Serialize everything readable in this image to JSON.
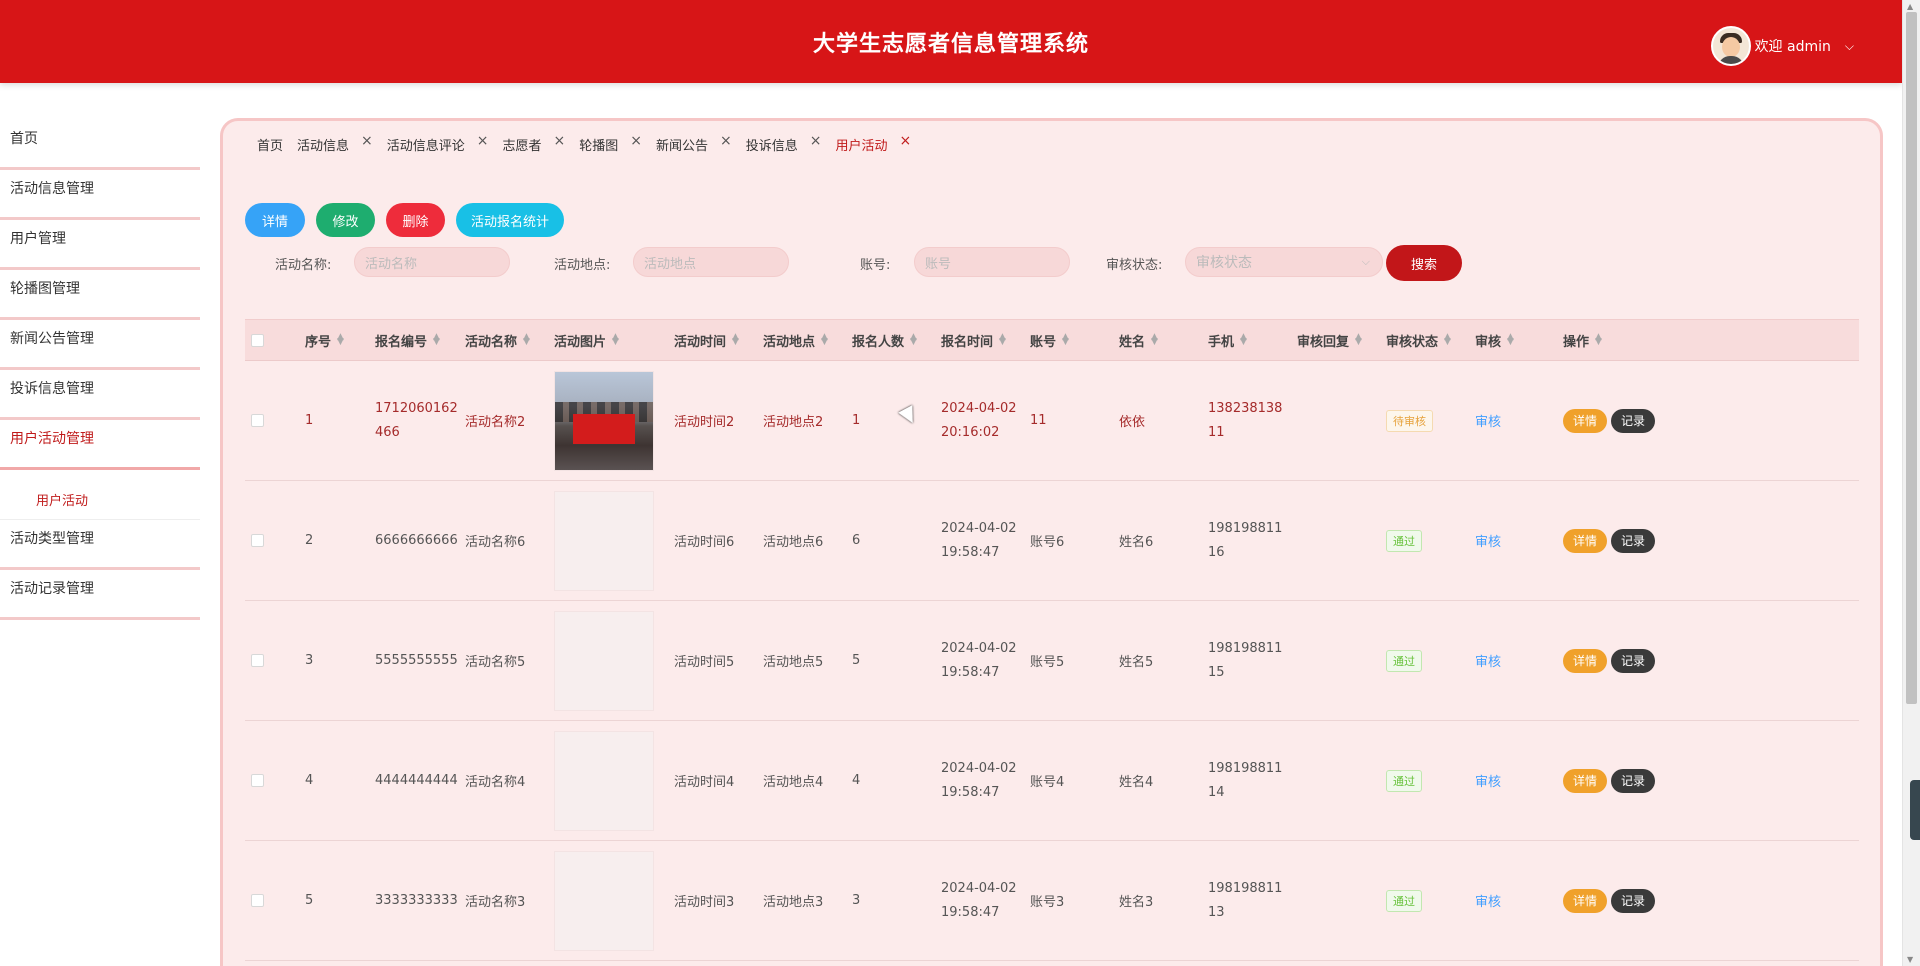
{
  "header": {
    "title": "大学生志愿者信息管理系统",
    "welcome": "欢迎 admin",
    "chevron": "⌵"
  },
  "sidebar": {
    "items": [
      {
        "label": "首页",
        "active": false
      },
      {
        "label": "活动信息管理",
        "active": false
      },
      {
        "label": "用户管理",
        "active": false
      },
      {
        "label": "轮播图管理",
        "active": false
      },
      {
        "label": "新闻公告管理",
        "active": false
      },
      {
        "label": "投诉信息管理",
        "active": false
      },
      {
        "label": "用户活动管理",
        "active": true
      },
      {
        "label": "活动类型管理",
        "active": false
      },
      {
        "label": "活动记录管理",
        "active": false
      }
    ],
    "sub_item": "用户活动"
  },
  "tabs": [
    {
      "label": "首页",
      "closable": false
    },
    {
      "label": "活动信息",
      "closable": true
    },
    {
      "label": "活动信息评论",
      "closable": true
    },
    {
      "label": "志愿者",
      "closable": true
    },
    {
      "label": "轮播图",
      "closable": true
    },
    {
      "label": "新闻公告",
      "closable": true
    },
    {
      "label": "投诉信息",
      "closable": true
    },
    {
      "label": "用户活动",
      "closable": true,
      "active": true
    }
  ],
  "actions": {
    "detail": "详情",
    "edit": "修改",
    "delete": "删除",
    "stat": "活动报名统计"
  },
  "search": {
    "name_label": "活动名称:",
    "name_placeholder": "活动名称",
    "place_label": "活动地点:",
    "place_placeholder": "活动地点",
    "account_label": "账号:",
    "account_placeholder": "账号",
    "status_label": "审核状态:",
    "status_placeholder": "审核状态",
    "button": "搜索"
  },
  "table": {
    "columns": [
      "序号",
      "报名编号",
      "活动名称",
      "活动图片",
      "活动时间",
      "活动地点",
      "报名人数",
      "报名时间",
      "账号",
      "姓名",
      "手机",
      "审核回复",
      "审核状态",
      "审核",
      "操作"
    ],
    "rows": [
      {
        "seq": "1",
        "no": "1712060162466",
        "name": "活动名称2",
        "image": "photo",
        "time": "活动时间2",
        "place": "活动地点2",
        "count": "1",
        "signup_date": "2024-04-02",
        "signup_time": "20:16:02",
        "account": "11",
        "realname": "依依",
        "phone": "13823813811",
        "reply": "",
        "status": "待审核",
        "review": "审核"
      },
      {
        "seq": "2",
        "no": "6666666666",
        "name": "活动名称6",
        "image": "blank",
        "time": "活动时间6",
        "place": "活动地点6",
        "count": "6",
        "signup_date": "2024-04-02",
        "signup_time": "19:58:47",
        "account": "账号6",
        "realname": "姓名6",
        "phone": "19819881116",
        "reply": "",
        "status": "通过",
        "review": "审核"
      },
      {
        "seq": "3",
        "no": "5555555555",
        "name": "活动名称5",
        "image": "blank",
        "time": "活动时间5",
        "place": "活动地点5",
        "count": "5",
        "signup_date": "2024-04-02",
        "signup_time": "19:58:47",
        "account": "账号5",
        "realname": "姓名5",
        "phone": "19819881115",
        "reply": "",
        "status": "通过",
        "review": "审核"
      },
      {
        "seq": "4",
        "no": "4444444444",
        "name": "活动名称4",
        "image": "blank",
        "time": "活动时间4",
        "place": "活动地点4",
        "count": "4",
        "signup_date": "2024-04-02",
        "signup_time": "19:58:47",
        "account": "账号4",
        "realname": "姓名4",
        "phone": "19819881114",
        "reply": "",
        "status": "通过",
        "review": "审核"
      },
      {
        "seq": "5",
        "no": "3333333333",
        "name": "活动名称3",
        "image": "blank",
        "time": "活动时间3",
        "place": "活动地点3",
        "count": "3",
        "signup_date": "2024-04-02",
        "signup_time": "19:58:47",
        "account": "账号3",
        "realname": "姓名3",
        "phone": "19819881113",
        "reply": "",
        "status": "通过",
        "review": "审核"
      }
    ],
    "op_detail": "详情",
    "op_record": "记录"
  }
}
